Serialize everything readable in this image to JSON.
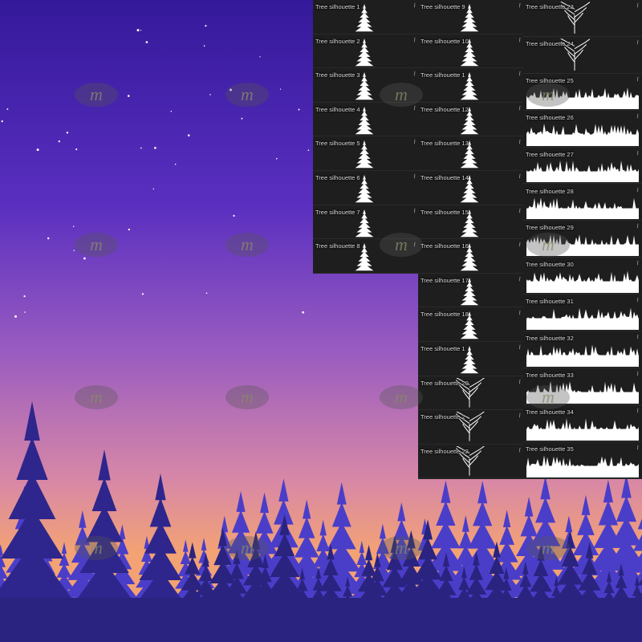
{
  "colors": {
    "sky_top": "#3a1f9c",
    "sky_mid": "#7145c2",
    "sky_horizon": "#f0a276",
    "forest_back": "#4a3ec9",
    "forest_front": "#2a2380",
    "panel_bg": "#1e1e1e",
    "label": "#d9d9d9",
    "watermark": "#6a6a6a"
  },
  "watermark": {
    "glyph": "m"
  },
  "brush_icon": "pencil-icon",
  "columns": [
    {
      "name": "column-1",
      "items": [
        {
          "label": "Tree silhouette 1",
          "kind": "single-pine"
        },
        {
          "label": "Tree silhouette 2",
          "kind": "single-pine"
        },
        {
          "label": "Tree silhouette 3",
          "kind": "single-pine"
        },
        {
          "label": "Tree silhouette 4",
          "kind": "single-pine"
        },
        {
          "label": "Tree silhouette 5",
          "kind": "single-pine"
        },
        {
          "label": "Tree silhouette 6",
          "kind": "single-pine"
        },
        {
          "label": "Tree silhouette 7",
          "kind": "single-pine"
        },
        {
          "label": "Tree silhouette 8",
          "kind": "single-pine"
        }
      ]
    },
    {
      "name": "column-2",
      "items": [
        {
          "label": "Tree silhouette 9",
          "kind": "single-pine"
        },
        {
          "label": "Tree silhouette 10",
          "kind": "single-pine"
        },
        {
          "label": "Tree silhouette 1",
          "kind": "single-pine"
        },
        {
          "label": "Tree silhouette 12",
          "kind": "single-pine"
        },
        {
          "label": "Tree silhouette 13",
          "kind": "single-pine"
        },
        {
          "label": "Tree silhouette 14",
          "kind": "single-pine"
        },
        {
          "label": "Tree silhouette 15",
          "kind": "single-pine"
        },
        {
          "label": "Tree silhouette 16",
          "kind": "single-pine"
        },
        {
          "label": "Tree silhouette 17",
          "kind": "single-pine"
        },
        {
          "label": "Tree silhouette 18",
          "kind": "single-pine"
        },
        {
          "label": "Tree silhouette 1",
          "kind": "single-pine"
        },
        {
          "label": "Tree silhouette 20",
          "kind": "bare-tree"
        },
        {
          "label": "Tree silhouette 2",
          "kind": "bare-tree"
        },
        {
          "label": "Tree silhouette 22",
          "kind": "bare-tree"
        }
      ]
    },
    {
      "name": "column-3",
      "items": [
        {
          "label": "Tree silhouette 23",
          "kind": "bare-tree"
        },
        {
          "label": "Tree silhouette 24",
          "kind": "bare-tree"
        },
        {
          "label": "Tree silhouette 25",
          "kind": "treeline"
        },
        {
          "label": "Tree silhouette 26",
          "kind": "treeline"
        },
        {
          "label": "Tree silhouette 27",
          "kind": "treeline"
        },
        {
          "label": "Tree silhouette 28",
          "kind": "treeline"
        },
        {
          "label": "Tree silhouette 29",
          "kind": "treeline"
        },
        {
          "label": "Tree silhouette 30",
          "kind": "treeline"
        },
        {
          "label": "Tree silhouette 31",
          "kind": "treeline"
        },
        {
          "label": "Tree silhouette 32",
          "kind": "treeline"
        },
        {
          "label": "Tree silhouette 33",
          "kind": "treeline"
        },
        {
          "label": "Tree silhouette 34",
          "kind": "treeline"
        },
        {
          "label": "Tree silhouette 35",
          "kind": "treeline"
        }
      ]
    }
  ]
}
